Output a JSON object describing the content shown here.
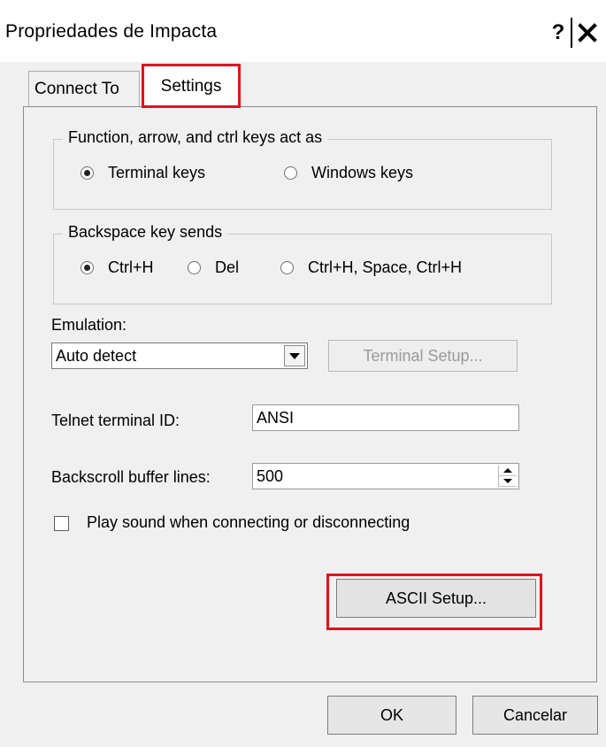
{
  "window": {
    "title": "Propriedades de Impacta",
    "help_label": "?",
    "close_label": "✕"
  },
  "tabs": [
    {
      "label": "Connect To",
      "active": false
    },
    {
      "label": "Settings",
      "active": true
    }
  ],
  "function_keys_group": {
    "label": "Function, arrow, and ctrl keys act as",
    "options": [
      {
        "label": "Terminal keys",
        "selected": true
      },
      {
        "label": "Windows keys",
        "selected": false
      }
    ]
  },
  "backspace_group": {
    "label": "Backspace key sends",
    "options": [
      {
        "label": "Ctrl+H",
        "selected": true
      },
      {
        "label": "Del",
        "selected": false
      },
      {
        "label": "Ctrl+H, Space, Ctrl+H",
        "selected": false
      }
    ]
  },
  "emulation": {
    "label": "Emulation:",
    "value": "Auto detect",
    "terminal_setup_label": "Terminal Setup..."
  },
  "telnet": {
    "label": "Telnet terminal ID:",
    "value": "ANSI"
  },
  "backscroll": {
    "label": "Backscroll buffer lines:",
    "value": "500"
  },
  "play_sound": {
    "label": "Play sound when connecting or disconnecting",
    "checked": false
  },
  "ascii_setup_label": "ASCII Setup...",
  "footer": {
    "ok_label": "OK",
    "cancel_label": "Cancelar"
  },
  "colors": {
    "highlight": "#e0141e",
    "dialog_bg": "#f0f0f0"
  }
}
